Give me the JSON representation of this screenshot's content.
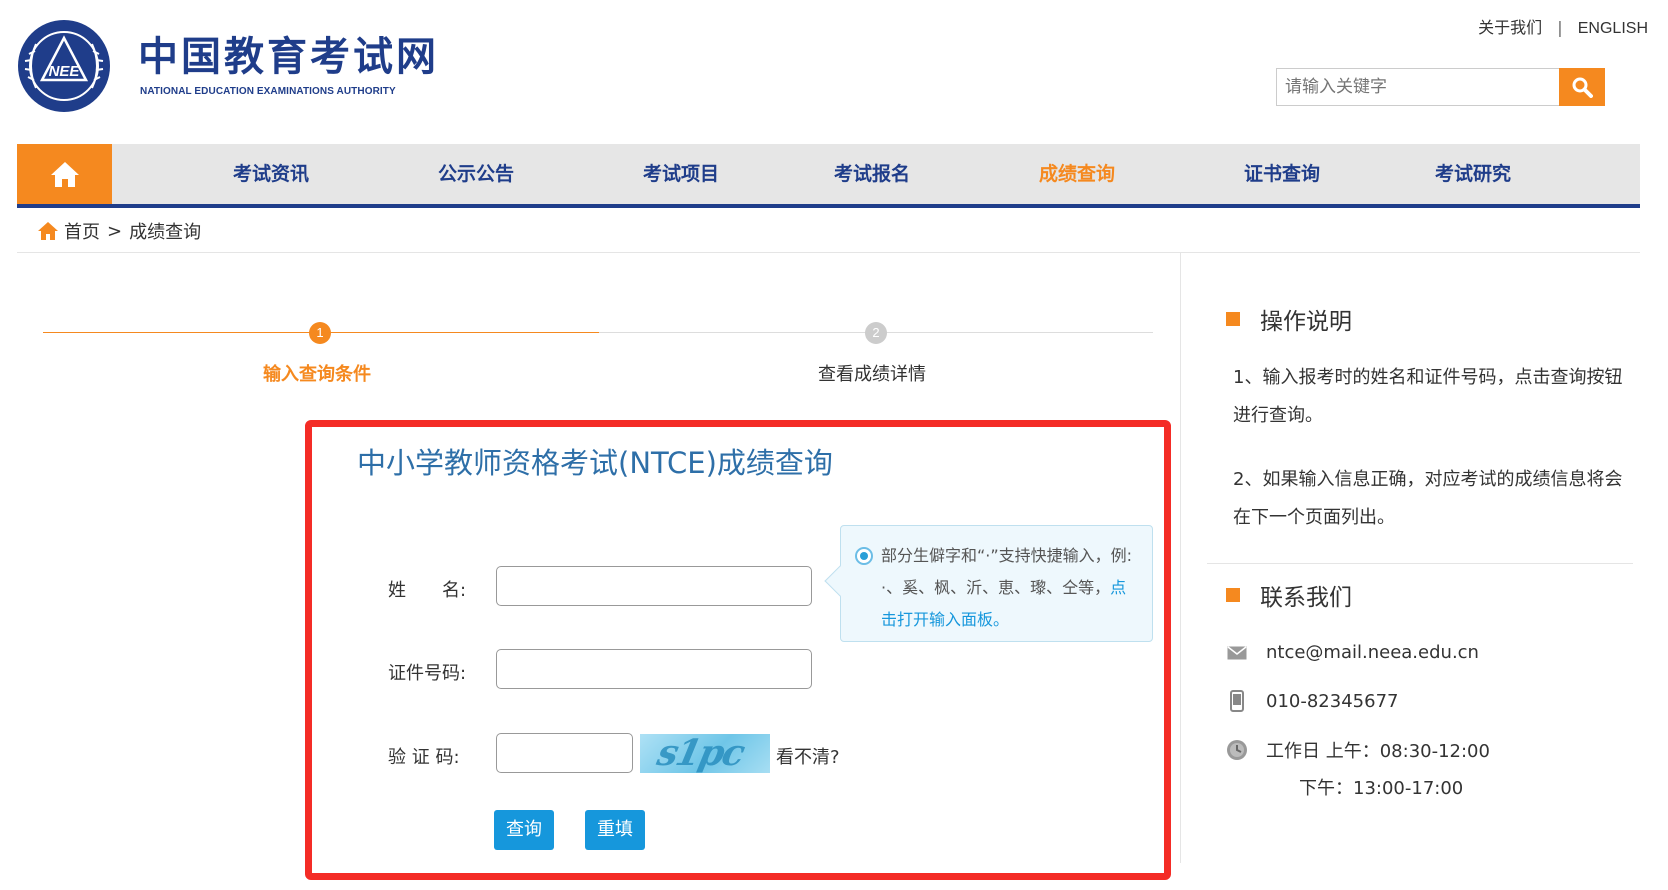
{
  "header": {
    "logo_cn": "中国教育考试网",
    "logo_en": "NATIONAL EDUCATION EXAMINATIONS AUTHORITY",
    "logo_emblem_text": "NEEA",
    "links": [
      "关于我们",
      "ENGLISH"
    ],
    "link_sep": "|",
    "search_placeholder": "请输入关键字"
  },
  "nav": {
    "items": [
      "考试资讯",
      "公示公告",
      "考试项目",
      "考试报名",
      "成绩查询",
      "证书查询",
      "考试研究"
    ],
    "active": "成绩查询"
  },
  "breadcrumb": {
    "home": "首页",
    "sep": ">",
    "current": "成绩查询"
  },
  "steps": [
    {
      "num": "1",
      "label": "输入查询条件",
      "active": true
    },
    {
      "num": "2",
      "label": "查看成绩详情",
      "active": false
    }
  ],
  "form": {
    "title": "中小学教师资格考试(NTCE)成绩查询",
    "name_label": "姓　　名:",
    "id_label": "证件号码:",
    "captcha_label": "验 证 码:",
    "captcha_text": "s1pc",
    "captcha_hint": "看不清?",
    "submit": "查询",
    "reset": "重填"
  },
  "tooltip": {
    "text": "部分生僻字和“·”支持快捷输入，例: ·、奚、枫、沂、恵、瓈、仝等，",
    "link": "点击打开输入面板。"
  },
  "sidebar": {
    "instructions_title": "操作说明",
    "instructions": [
      "1、输入报考时的姓名和证件号码，点击查询按钮进行查询。",
      "2、如果输入信息正确，对应考试的成绩信息将会在下一个页面列出。"
    ],
    "contact_title": "联系我们",
    "email": "ntce@mail.neea.edu.cn",
    "phone": "010-82345677",
    "hours_am": "工作日 上午：08:30-12:00",
    "hours_pm": "下午：13:00-17:00"
  },
  "colors": {
    "brand_blue": "#1f3d8a",
    "accent_orange": "#f5891f",
    "button_blue": "#1697dc",
    "highlight_red": "#f42c26"
  }
}
